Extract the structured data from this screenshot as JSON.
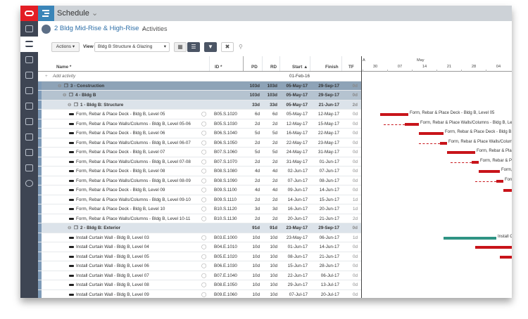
{
  "app": {
    "title": "Schedule"
  },
  "breadcrumb": {
    "project": "2 Bldg Mid-Rise & High-Rise",
    "page": "Activities"
  },
  "toolbar": {
    "actions": "Actions",
    "view_label": "View",
    "view_value": "Bldg B Structure & Glazing"
  },
  "columns": {
    "name": "Name *",
    "id": "ID *",
    "pd": "PD",
    "rd": "RD",
    "start": "Start",
    "finish": "Finish",
    "tf": "TF"
  },
  "add_row": {
    "label": "Add activity",
    "start": "01-Feb-16"
  },
  "timeline": {
    "month_a": "A",
    "month_may": "May",
    "weeks": [
      "30",
      "07",
      "14",
      "21",
      "28",
      "04"
    ]
  },
  "colors": {
    "critical": "#c8141a",
    "noncritical": "#2f9484"
  },
  "rows": [
    {
      "type": "group",
      "level": 0,
      "name": "3 - Construction",
      "pd": "103d",
      "rd": "103d",
      "start": "05-May-17",
      "finish": "29-Sep-17",
      "tf": "0d"
    },
    {
      "type": "group",
      "level": 1,
      "name": "4 - Bldg B",
      "pd": "103d",
      "rd": "103d",
      "start": "05-May-17",
      "finish": "29-Sep-17",
      "tf": "0d"
    },
    {
      "type": "group",
      "level": 2,
      "name": "1 - Bldg B: Structure",
      "pd": "33d",
      "rd": "33d",
      "start": "05-May-17",
      "finish": "21-Jun-17",
      "tf": "2d"
    },
    {
      "type": "act",
      "name": "Form, Rebar & Place Deck - Bldg B, Level 05",
      "id": "B05.S.1020",
      "pd": "6d",
      "rd": "6d",
      "start": "05-May-17",
      "finish": "12-May-17",
      "tf": "0d",
      "critical": true
    },
    {
      "type": "act",
      "name": "Form, Rebar & Place Walls/Columns - Bldg B, Level 05-06",
      "id": "B05.S.1030",
      "pd": "2d",
      "rd": "2d",
      "start": "12-May-17",
      "finish": "15-May-17",
      "tf": "0d",
      "critical": true
    },
    {
      "type": "act",
      "name": "Form, Rebar & Place Deck - Bldg B, Level 06",
      "id": "B06.S.1040",
      "pd": "5d",
      "rd": "5d",
      "start": "16-May-17",
      "finish": "22-May-17",
      "tf": "0d",
      "critical": true
    },
    {
      "type": "act",
      "name": "Form, Rebar & Place Walls/Columns - Bldg B, Level 06-07",
      "id": "B06.S.1050",
      "pd": "2d",
      "rd": "2d",
      "start": "22-May-17",
      "finish": "23-May-17",
      "tf": "0d",
      "critical": true
    },
    {
      "type": "act",
      "name": "Form, Rebar & Place Deck - Bldg B, Level 07",
      "id": "B07.S.1060",
      "pd": "5d",
      "rd": "5d",
      "start": "24-May-17",
      "finish": "31-May-17",
      "tf": "0d",
      "critical": true
    },
    {
      "type": "act",
      "name": "Form, Rebar & Place Walls/Columns - Bldg B, Level 07-08",
      "id": "B07.S.1070",
      "pd": "2d",
      "rd": "2d",
      "start": "31-May-17",
      "finish": "01-Jun-17",
      "tf": "0d",
      "critical": true
    },
    {
      "type": "act",
      "name": "Form, Rebar & Place Deck - Bldg B, Level 08",
      "id": "B08.S.1080",
      "pd": "4d",
      "rd": "4d",
      "start": "02-Jun-17",
      "finish": "07-Jun-17",
      "tf": "0d",
      "critical": true
    },
    {
      "type": "act",
      "name": "Form, Rebar & Place Walls/Columns - Bldg B, Level 08-09",
      "id": "B08.S.1090",
      "pd": "2d",
      "rd": "2d",
      "start": "07-Jun-17",
      "finish": "08-Jun-17",
      "tf": "0d",
      "critical": true
    },
    {
      "type": "act",
      "name": "Form, Rebar & Place Deck - Bldg B, Level 09",
      "id": "B09.S.1100",
      "pd": "4d",
      "rd": "4d",
      "start": "09-Jun-17",
      "finish": "14-Jun-17",
      "tf": "0d",
      "critical": true
    },
    {
      "type": "act",
      "name": "Form, Rebar & Place Walls/Columns - Bldg B, Level 09-10",
      "id": "B09.S.1110",
      "pd": "2d",
      "rd": "2d",
      "start": "14-Jun-17",
      "finish": "15-Jun-17",
      "tf": "1d",
      "critical": true
    },
    {
      "type": "act",
      "name": "Form, Rebar & Place Deck - Bldg B, Level 10",
      "id": "B10.S.1120",
      "pd": "3d",
      "rd": "3d",
      "start": "16-Jun-17",
      "finish": "20-Jun-17",
      "tf": "1d",
      "critical": true
    },
    {
      "type": "act",
      "name": "Form, Rebar & Place Walls/Columns - Bldg B, Level 10-11",
      "id": "B10.S.1130",
      "pd": "2d",
      "rd": "2d",
      "start": "20-Jun-17",
      "finish": "21-Jun-17",
      "tf": "2d",
      "critical": true
    },
    {
      "type": "group",
      "level": 2,
      "name": "2 - Bldg B: Exterior",
      "pd": "91d",
      "rd": "91d",
      "start": "23-May-17",
      "finish": "29-Sep-17",
      "tf": "0d"
    },
    {
      "type": "act",
      "name": "Install Curtain Wall - Bldg B, Level 03",
      "id": "B03.E.1000",
      "pd": "10d",
      "rd": "10d",
      "start": "23-May-17",
      "finish": "06-Jun-17",
      "tf": "1d",
      "critical": false
    },
    {
      "type": "act",
      "name": "Install Curtain Wall - Bldg B, Level 04",
      "id": "B04.E.1010",
      "pd": "10d",
      "rd": "10d",
      "start": "01-Jun-17",
      "finish": "14-Jun-17",
      "tf": "0d",
      "critical": true
    },
    {
      "type": "act",
      "name": "Install Curtain Wall - Bldg B, Level 05",
      "id": "B05.E.1020",
      "pd": "10d",
      "rd": "10d",
      "start": "08-Jun-17",
      "finish": "21-Jun-17",
      "tf": "0d",
      "critical": true
    },
    {
      "type": "act",
      "name": "Install Curtain Wall - Bldg B, Level 06",
      "id": "B06.E.1030",
      "pd": "10d",
      "rd": "10d",
      "start": "15-Jun-17",
      "finish": "28-Jun-17",
      "tf": "0d",
      "critical": true
    },
    {
      "type": "act",
      "name": "Install Curtain Wall - Bldg B, Level 07",
      "id": "B07.E.1040",
      "pd": "10d",
      "rd": "10d",
      "start": "22-Jun-17",
      "finish": "06-Jul-17",
      "tf": "0d",
      "critical": true
    },
    {
      "type": "act",
      "name": "Install Curtain Wall - Bldg B, Level 08",
      "id": "B08.E.1050",
      "pd": "10d",
      "rd": "10d",
      "start": "29-Jun-17",
      "finish": "13-Jul-17",
      "tf": "0d",
      "critical": true
    },
    {
      "type": "act",
      "name": "Install Curtain Wall - Bldg B, Level 09",
      "id": "B09.E.1060",
      "pd": "10d",
      "rd": "10d",
      "start": "07-Jul-17",
      "finish": "20-Jul-17",
      "tf": "0d",
      "critical": true
    }
  ]
}
